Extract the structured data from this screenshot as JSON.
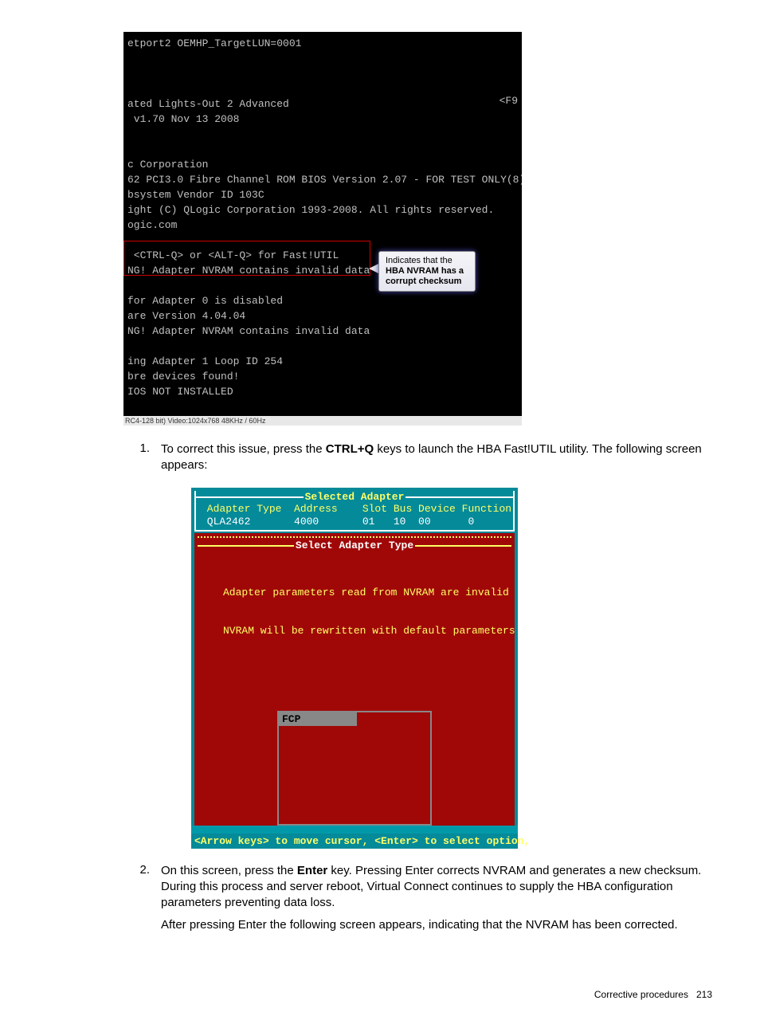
{
  "fig1": {
    "l0": "etport2 OEMHP_TargetLUN=0001",
    "blank": " ",
    "l1": "ated Lights-Out 2 Advanced",
    "l2": " v1.70 Nov 13 2008",
    "l3": "c Corporation",
    "l4": "62 PCI3.0 Fibre Channel ROM BIOS Version 2.07 - FOR TEST ONLY(8)",
    "l5": "bsystem Vendor ID 103C",
    "l6": "ight (C) QLogic Corporation 1993-2008. All rights reserved.",
    "l7": "ogic.com",
    "l8": " <CTRL-Q> or <ALT-Q> for Fast!UTIL",
    "l9": "NG! Adapter NVRAM contains invalid data",
    "l10": "for Adapter 0 is disabled",
    "l11": "are Version 4.04.04",
    "l12": "NG! Adapter NVRAM contains invalid data",
    "l13": "ing Adapter 1 Loop ID 254",
    "l14": "bre devices found!",
    "l15": "IOS NOT INSTALLED",
    "f9": "<F9",
    "tooltip_l1": "Indicates that the",
    "tooltip_l2": "HBA NVRAM has a",
    "tooltip_l3": "corrupt checksum",
    "status_left": "RC4-128 bit)  Video:1024x768  48KHz / 60Hz",
    "status_right": ""
  },
  "step1": {
    "num": "1.",
    "pre": "To correct this issue, press the ",
    "key": "CTRL+Q",
    "post": " keys to launch the HBA Fast!UTIL utility. The following screen appears:"
  },
  "fig2": {
    "title1": "Selected Adapter",
    "hdr": " Adapter Type  Address    Slot Bus Device Function",
    "row": " QLA2462       4000       01   10  00      0",
    "title2": "Select Adapter Type",
    "msg1": "Adapter parameters read from NVRAM are invalid",
    "msg2": "NVRAM will be rewritten with default parameters",
    "fcp": "FCP",
    "hint": "<Arrow keys> to move cursor, <Enter> to select option,"
  },
  "step2": {
    "num": "2.",
    "pre": "On this screen, press the ",
    "key": "Enter",
    "post": " key. Pressing Enter corrects NVRAM and generates a new checksum. During this process and server reboot, Virtual Connect continues to supply the HBA configuration parameters preventing data loss.",
    "para2": "After pressing Enter the following screen appears, indicating that the NVRAM has been corrected."
  },
  "footer": {
    "section": "Corrective procedures",
    "page": "213"
  }
}
